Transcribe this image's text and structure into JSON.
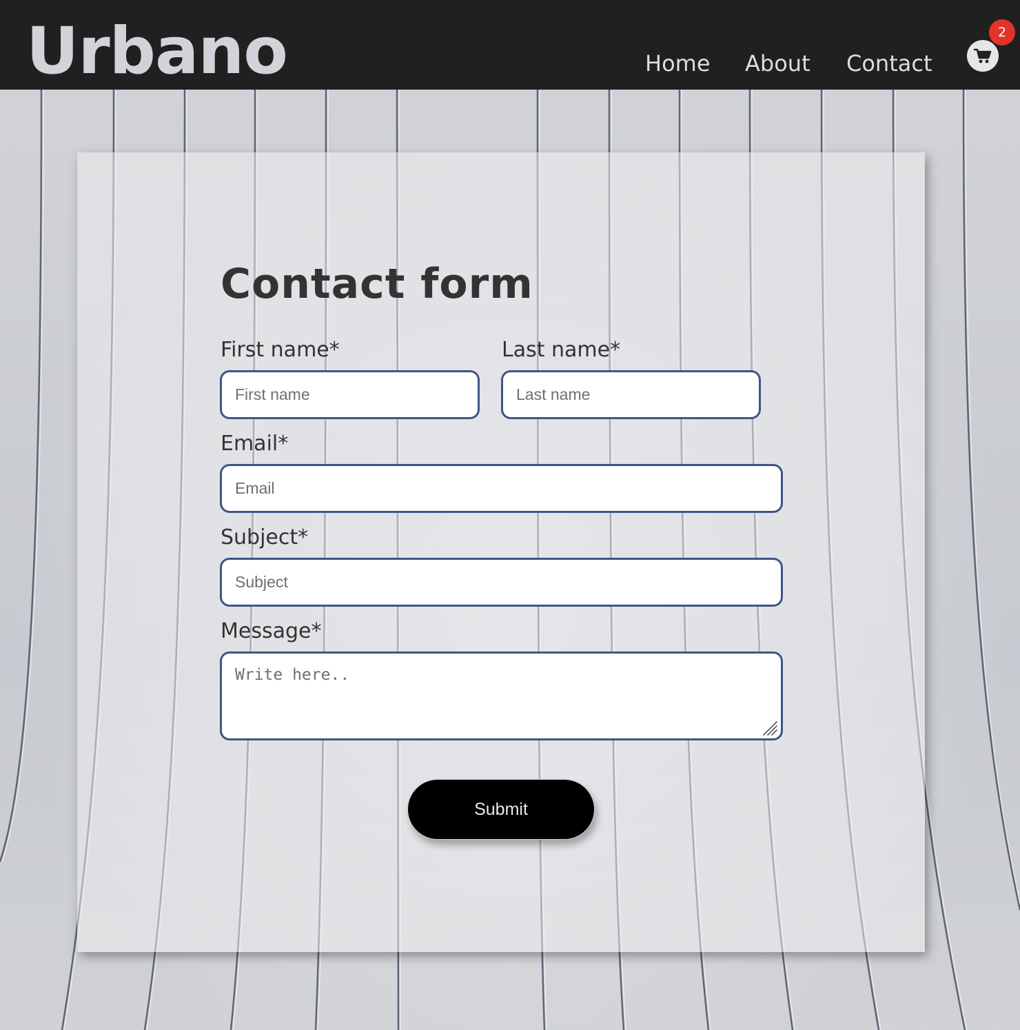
{
  "header": {
    "logo": "Urbano",
    "nav": [
      {
        "label": "Home"
      },
      {
        "label": "About"
      },
      {
        "label": "Contact"
      }
    ],
    "cart_count": "2"
  },
  "form": {
    "title": "Contact form",
    "first_name": {
      "label": "First name*",
      "placeholder": "First name"
    },
    "last_name": {
      "label": "Last name*",
      "placeholder": "Last name"
    },
    "email": {
      "label": "Email*",
      "placeholder": "Email"
    },
    "subject": {
      "label": "Subject*",
      "placeholder": "Subject"
    },
    "message": {
      "label": "Message*",
      "placeholder": "Write here.."
    },
    "submit_label": "Submit"
  },
  "colors": {
    "header_bg": "#1f2020",
    "badge": "#e2342a",
    "input_border": "#3f5486",
    "button_bg": "#000000"
  }
}
